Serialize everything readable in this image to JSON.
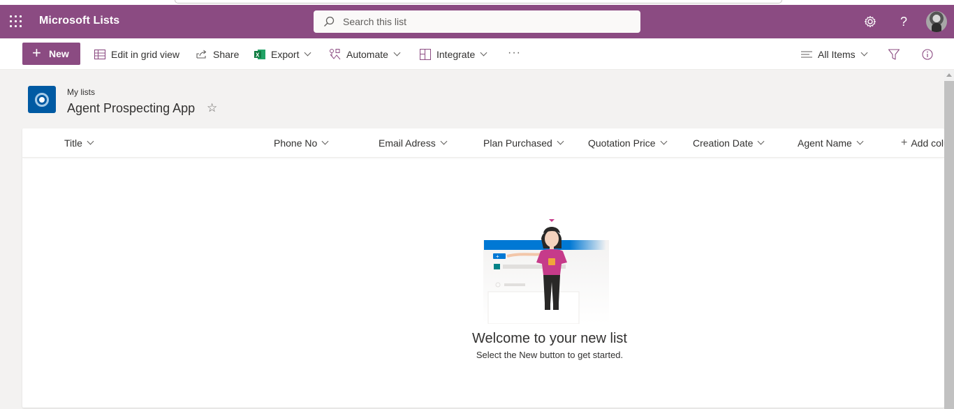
{
  "suite": {
    "app_title": "Microsoft Lists",
    "search_placeholder": "Search this list",
    "accent_color": "#8b4b82"
  },
  "commandbar": {
    "new_label": "New",
    "items": [
      {
        "label": "Edit in grid view",
        "icon": "grid-icon"
      },
      {
        "label": "Share",
        "icon": "share-icon"
      },
      {
        "label": "Export",
        "icon": "excel-icon"
      },
      {
        "label": "Automate",
        "icon": "automate-icon"
      },
      {
        "label": "Integrate",
        "icon": "integrate-icon"
      }
    ],
    "more": "···",
    "view_label": "All Items"
  },
  "page": {
    "breadcrumb": "My lists",
    "title": "Agent Prospecting App"
  },
  "columns": [
    "Title",
    "Phone No",
    "Email Adress",
    "Plan Purchased",
    "Quotation Price",
    "Creation Date",
    "Agent Name"
  ],
  "add_column_label": "Add column",
  "empty_state": {
    "heading": "Welcome to your new list",
    "subtext": "Select the New button to get started."
  }
}
